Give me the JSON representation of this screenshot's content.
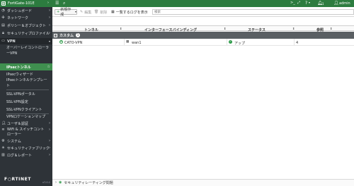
{
  "app": {
    "device_name": "FortiGate-101E",
    "admin_name": "admin",
    "notification_count": "1",
    "brand_text": "F○RTINET",
    "version_text": "v7.0.1"
  },
  "sidebar": {
    "items": [
      {
        "label": "ダッシュボード"
      },
      {
        "label": "ネットワーク"
      },
      {
        "label": "ポリシー＆オブジェクト"
      },
      {
        "label": "セキュリティプロファイル"
      },
      {
        "label": "VPN"
      },
      {
        "label": "オーバーレイコントローラーVPN"
      },
      {
        "label": "IPsecトンネル"
      },
      {
        "label": "IPsecウィザード"
      },
      {
        "label": "IPsecトンネルテンプレート"
      },
      {
        "label": "SSL-VPNポータル"
      },
      {
        "label": "SSL-VPN設定"
      },
      {
        "label": "SSL-VPNクライアント"
      },
      {
        "label": "VPNロケーションマップ"
      },
      {
        "label": "ユーザ＆認証"
      },
      {
        "label": "WiFi & スイッチコントローラー"
      },
      {
        "label": "システム"
      },
      {
        "label": "セキュリティファブリック"
      },
      {
        "label": "ログ＆レポート"
      }
    ]
  },
  "toolbar": {
    "new_label": "新規作成",
    "edit_label": "編集",
    "delete_label": "削除",
    "log_label": "一覧するログを表示",
    "search_placeholder": "検索"
  },
  "table": {
    "columns": [
      "トンネル",
      "インターフェースバインディング",
      "ステータス",
      "参照"
    ],
    "group": {
      "name": "カスタム",
      "count": "1"
    },
    "rows": [
      {
        "tunnel": "CATO-VPN",
        "interface": "wan1",
        "status": "アップ",
        "refs": "4"
      }
    ]
  },
  "footer": {
    "rating_label": "セキュリティレーティング問題"
  },
  "colors": {
    "brand_green": "#2c7c3f",
    "sidebar_bg": "#2e3338",
    "active_item": "#3f8f4f",
    "status_up": "#2f9b4a"
  }
}
